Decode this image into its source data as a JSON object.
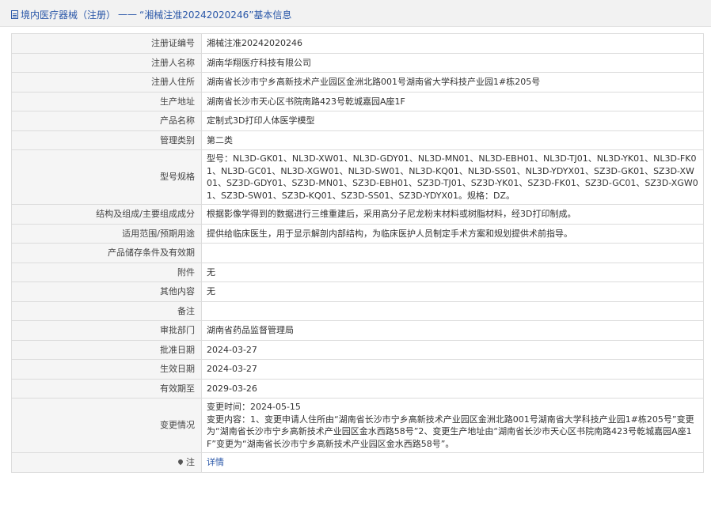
{
  "header": {
    "breadcrumb_root": "境内医疗器械（注册）",
    "separator": "——",
    "title": "“湘械注准20242020246”基本信息"
  },
  "rows": [
    {
      "label": "注册证编号",
      "value": "湘械注准20242020246"
    },
    {
      "label": "注册人名称",
      "value": "湖南华翔医疗科技有限公司"
    },
    {
      "label": "注册人住所",
      "value": "湖南省长沙市宁乡高新技术产业园区金洲北路001号湖南省大学科技产业园1#栋205号"
    },
    {
      "label": "生产地址",
      "value": "湖南省长沙市天心区书院南路423号乾城嘉园A座1F"
    },
    {
      "label": "产品名称",
      "value": "定制式3D打印人体医学模型"
    },
    {
      "label": "管理类别",
      "value": "第二类"
    },
    {
      "label": "型号规格",
      "value": "型号：NL3D-GK01、NL3D-XW01、NL3D-GDY01、NL3D-MN01、NL3D-EBH01、NL3D-TJ01、NL3D-YK01、NL3D-FK01、NL3D-GC01、NL3D-XGW01、NL3D-SW01、NL3D-KQ01、NL3D-SS01、NL3D-YDYX01、SZ3D-GK01、SZ3D-XW01、SZ3D-GDY01、SZ3D-MN01、SZ3D-EBH01、SZ3D-TJ01、SZ3D-YK01、SZ3D-FK01、SZ3D-GC01、SZ3D-XGW01、SZ3D-SW01、SZ3D-KQ01、SZ3D-SS01、SZ3D-YDYX01。规格：DZ。"
    },
    {
      "label": "结构及组成/主要组成成分",
      "value": "根据影像学得到的数据进行三维重建后，采用高分子尼龙粉末材料或树脂材料，经3D打印制成。"
    },
    {
      "label": "适用范围/预期用途",
      "value": "提供给临床医生，用于显示解剖内部结构，为临床医护人员制定手术方案和规划提供术前指导。"
    },
    {
      "label": "产品储存条件及有效期",
      "value": ""
    },
    {
      "label": "附件",
      "value": "无"
    },
    {
      "label": "其他内容",
      "value": "无"
    },
    {
      "label": "备注",
      "value": ""
    },
    {
      "label": "审批部门",
      "value": "湖南省药品监督管理局"
    },
    {
      "label": "批准日期",
      "value": "2024-03-27"
    },
    {
      "label": "生效日期",
      "value": "2024-03-27"
    },
    {
      "label": "有效期至",
      "value": "2029-03-26"
    }
  ],
  "change": {
    "label": "变更情况",
    "time": "变更时间：2024-05-15",
    "content": "变更内容：1、变更申请人住所由“湖南省长沙市宁乡高新技术产业园区金洲北路001号湖南省大学科技产业园1#栋205号”变更为“湖南省长沙市宁乡高新技术产业园区金水西路58号”2、变更生产地址由“湖南省长沙市天心区书院南路423号乾城嘉园A座1F”变更为“湖南省长沙市宁乡高新技术产业园区金水西路58号”。"
  },
  "note": {
    "label": "注",
    "link": "详情"
  }
}
